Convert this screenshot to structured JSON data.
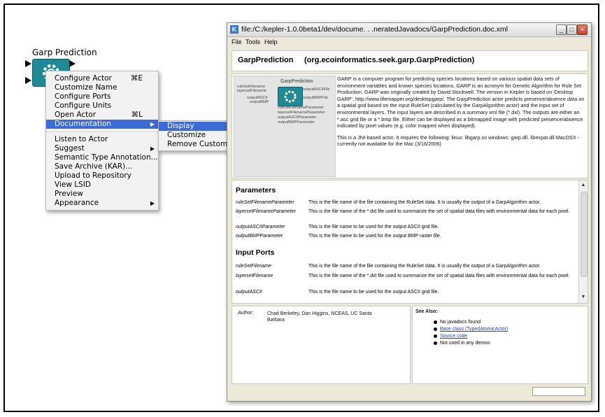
{
  "actor": {
    "title": "Garp Prediction",
    "icon": "gear-icon"
  },
  "context_menu": {
    "items": [
      {
        "label": "Configure Actor",
        "shortcut": "⌘E"
      },
      {
        "label": "Customize Name",
        "shortcut": ""
      },
      {
        "label": "Configure Ports",
        "shortcut": ""
      },
      {
        "label": "Configure Units",
        "shortcut": ""
      },
      {
        "label": "Open Actor",
        "shortcut": "⌘L"
      },
      {
        "label": "Documentation",
        "shortcut": "",
        "submenu": true,
        "active": true
      },
      {
        "label": "Listen to Actor",
        "shortcut": ""
      },
      {
        "label": "Suggest",
        "shortcut": "",
        "submenu": true
      },
      {
        "label": "Semantic Type Annotation...",
        "shortcut": ""
      },
      {
        "label": "Save Archive (KAR)...",
        "shortcut": ""
      },
      {
        "label": "Upload to Repository",
        "shortcut": ""
      },
      {
        "label": "View LSID",
        "shortcut": ""
      },
      {
        "label": "Preview",
        "shortcut": ""
      },
      {
        "label": "Appearance",
        "shortcut": "",
        "submenu": true
      }
    ]
  },
  "submenu": {
    "items": [
      "Display",
      "Customize",
      "Remove Customization"
    ]
  },
  "doc_window": {
    "title": "file:/C:/kepler-1.0.0beta1/dev/docume. . .neratedJavadocs/GarpPrediction.doc.xml",
    "menu": [
      "File",
      "Tools",
      "Help"
    ],
    "name": "GarpPrediction",
    "class": "(org.ecoinformatics.seek.garp.GarpPrediction)",
    "thumb_labels": {
      "actor_name": "GarpPrediction",
      "in1": "ruleSetFilename",
      "in2": "layersetFilename",
      "out1": "outputASCIIFile",
      "out2": "outputBMPFile",
      "left3": "outputASCII",
      "left4": "outputBMP",
      "param1": "ruleSetFilenameParameter",
      "param2": "layersetFilenameParameter",
      "param3": "outputASCIIParameter",
      "param4": "outputBMPParameter"
    },
    "description_1": "GARP is a computer program for predicting species locations based on various spatial data sets of environment variables and known species locations. GARP is an acronym for Genetic Algorithm for Rule Set Production. GARP was originally created by David Stockwell. The version in Kepler is based on 'Desktop GARP', http://www.lifemapper.org/desktopgarp/. The GarpPrediction actor predicts presence/absence data on a spatial grid based on the input RuleSet (calculated by the GarpAlgorithm actor) and the input set of environmental layers. The input layers are described in a summary xml file (*.dxl). The outputs are either an *.asc grid file or a *.bmp file. Either can be displayed as a bitmapped image with predicted presence/absence indicated by pixel values (e.g. color mapped when displayed).",
    "description_2": "This is a JNI-based actor. It requires the following: linux: libgarp.so windows: garp.dll, libexpat.dll MacOSX - currently not available for the Mac (3/16/2006)",
    "parameters_heading": "Parameters",
    "parameters": [
      {
        "name": "ruleSetFilenameParameter",
        "desc": "This is the file name of the file containing the RuleSet data. It is usually the output of a GarpAlgorithm actor."
      },
      {
        "name": "layersetFilenameParameter",
        "desc": "This is the file name of the *.dxl file used to summarize the set of spatial data files with environmental data for each pixel."
      },
      {
        "name": "outputASCIIParameter",
        "desc": "This is the file name to be used for the output ASCII grid file."
      },
      {
        "name": "outputBMPParameter",
        "desc": "This is the file name to be used for the output BMP raster file."
      }
    ],
    "ports_heading": "Input Ports",
    "ports": [
      {
        "name": "ruleSetFilename",
        "desc": "This is the file name of the file containing the RuleSet data. It is usually the output of a GarpAlgorithm actor."
      },
      {
        "name": "layersetFilename",
        "desc": "This is the file name of the *.dxl file used to summarize the set of spatial data files with environmental data for each pixel."
      },
      {
        "name": "outputASCII",
        "desc": "This is the file name to be used for the output ASCII grid file."
      }
    ],
    "author_label": "Author:",
    "author": "Chad Berkeley, Dan Higgins, NCEAS, UC Santa Barbara",
    "see_also_label": "See Also:",
    "see_also": [
      {
        "text": "No javadocs found",
        "link": false
      },
      {
        "text": "Base class (TypedAtomicActor)",
        "link": true
      },
      {
        "text": "Source code",
        "link": true
      },
      {
        "text": "Not used in any demos",
        "link": false
      }
    ]
  }
}
